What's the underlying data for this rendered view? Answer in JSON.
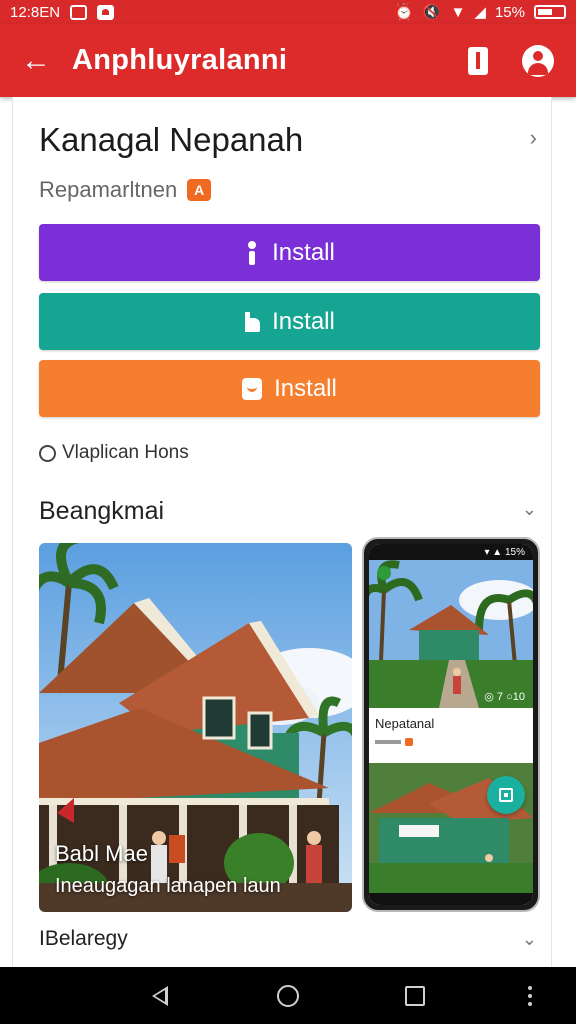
{
  "status_bar": {
    "time": "12:8EN",
    "battery": "15%"
  },
  "app_bar": {
    "title": "Anphluyralanni"
  },
  "app": {
    "name": "Kanagal Nepanah",
    "developer": "Repamarltnen",
    "developer_badge": "A"
  },
  "install_buttons": [
    {
      "label": "Install",
      "color": "#7b2fd6",
      "icon": "person-icon"
    },
    {
      "label": "Install",
      "color": "#17a593",
      "icon": "flag-icon"
    },
    {
      "label": "Install",
      "color": "#f57f2f",
      "icon": "bag-icon"
    }
  ],
  "option": {
    "label": "Vlaplican Hons"
  },
  "section": {
    "title": "Beangkmai"
  },
  "screenshots": {
    "main_caption_title": "Babl Mae",
    "main_caption_subtitle": "Ineaugagan lanapen laun",
    "phone": {
      "status": "▾ ▲ 15%",
      "tag": "",
      "counter": "◎ 7 ○10",
      "card_title": "Nepatanal"
    }
  },
  "footer": {
    "title": "IBelaregy"
  },
  "colors": {
    "accent": "#dd2a2a"
  }
}
